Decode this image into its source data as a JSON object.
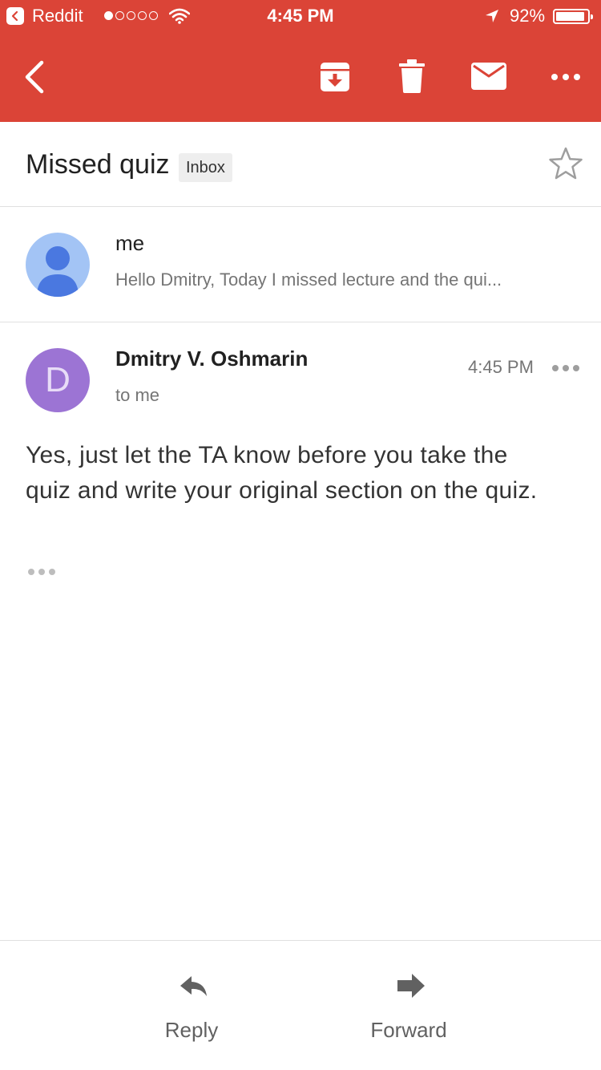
{
  "status_bar": {
    "back_app": "Reddit",
    "time": "4:45 PM",
    "battery_text": "92%",
    "battery_level": 0.92,
    "signal_bars_filled": 1,
    "signal_bars_total": 5
  },
  "toolbar": {
    "color": "#db4437",
    "icons": [
      "back-icon",
      "archive-icon",
      "delete-icon",
      "mark-unread-icon",
      "more-icon"
    ]
  },
  "thread": {
    "subject": "Missed quiz",
    "label": "Inbox"
  },
  "collapsed_message": {
    "sender": "me",
    "snippet": "Hello Dmitry, Today I missed lecture and the qui..."
  },
  "expanded_message": {
    "avatar_letter": "D",
    "avatar_color": "#9c74d4",
    "sender": "Dmitry V. Oshmarin",
    "recipient": "to me",
    "time": "4:45 PM",
    "body": "Yes, just let the TA know before you take the quiz and write your original section on the quiz."
  },
  "actions": {
    "reply_label": "Reply",
    "forward_label": "Forward"
  }
}
